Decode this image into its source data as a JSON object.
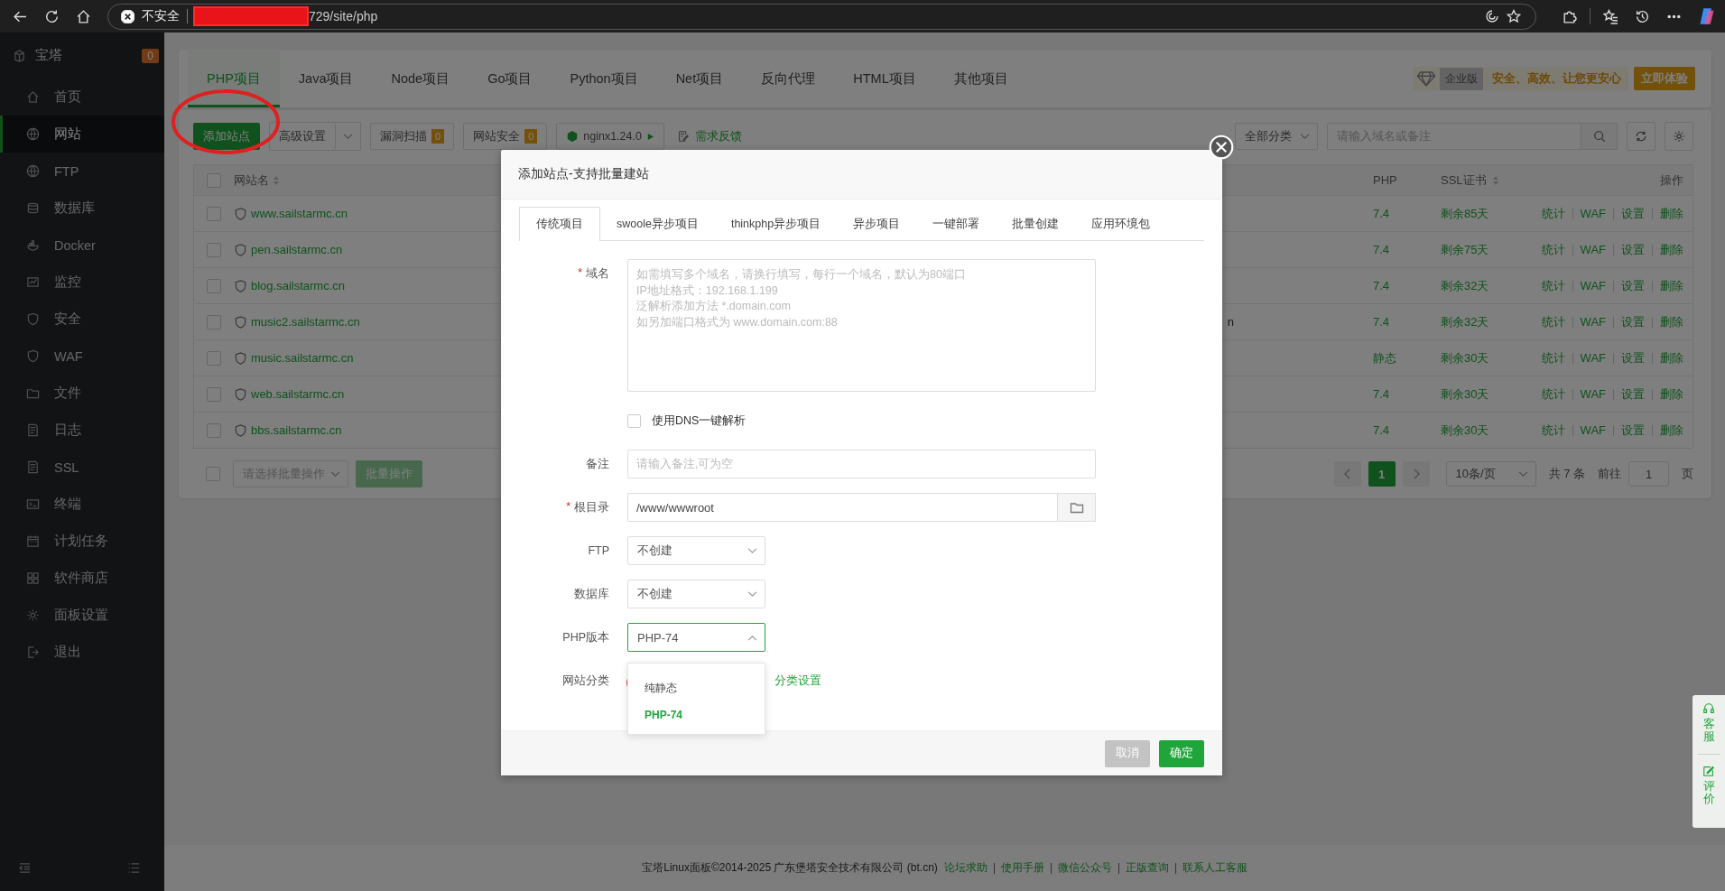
{
  "browser": {
    "security": "不安全",
    "url": "729/site/php"
  },
  "sidebar": {
    "title": "宝塔",
    "badge": "0",
    "items": [
      {
        "label": "首页",
        "selected": false
      },
      {
        "label": "网站",
        "selected": true
      },
      {
        "label": "FTP",
        "selected": false
      },
      {
        "label": "数据库",
        "selected": false
      },
      {
        "label": "Docker",
        "selected": false
      },
      {
        "label": "监控",
        "selected": false
      },
      {
        "label": "安全",
        "selected": false
      },
      {
        "label": "WAF",
        "selected": false
      },
      {
        "label": "文件",
        "selected": false
      },
      {
        "label": "日志",
        "selected": false
      },
      {
        "label": "SSL",
        "selected": false
      },
      {
        "label": "终端",
        "selected": false
      },
      {
        "label": "计划任务",
        "selected": false
      },
      {
        "label": "软件商店",
        "selected": false
      },
      {
        "label": "面板设置",
        "selected": false
      },
      {
        "label": "退出",
        "selected": false
      }
    ]
  },
  "project_tabs": [
    {
      "label": "PHP项目",
      "selected": true
    },
    {
      "label": "Java项目",
      "selected": false
    },
    {
      "label": "Node项目",
      "selected": false
    },
    {
      "label": "Go项目",
      "selected": false
    },
    {
      "label": "Python项目",
      "selected": false
    },
    {
      "label": "Net项目",
      "selected": false
    },
    {
      "label": "反向代理",
      "selected": false
    },
    {
      "label": "HTML项目",
      "selected": false
    },
    {
      "label": "其他项目",
      "selected": false
    }
  ],
  "promo": {
    "tag": "企业版",
    "text": "安全、高效、让您更安心",
    "button": "立即体验"
  },
  "toolbar": {
    "add_site": "添加站点",
    "advanced": "高级设置",
    "scan": "漏洞扫描",
    "scan_count": "0",
    "security": "网站安全",
    "security_count": "0",
    "nginx": "nginx1.24.0",
    "feedback": "需求反馈",
    "category": "全部分类",
    "search_placeholder": "请输入域名或备注"
  },
  "table": {
    "all_checked": false,
    "columns": [
      "网站名",
      "PHP",
      "SSL证书",
      "操作"
    ],
    "rows": [
      {
        "name": "www.sailstarmc.cn",
        "checked": false,
        "php": "7.4",
        "ssl": "剩余85天",
        "actions": [
          "统计",
          "WAF",
          "设置",
          "删除"
        ]
      },
      {
        "name": "pen.sailstarmc.cn",
        "checked": false,
        "php": "7.4",
        "ssl": "剩余75天",
        "actions": [
          "统计",
          "WAF",
          "设置",
          "删除"
        ]
      },
      {
        "name": "blog.sailstarmc.cn",
        "checked": false,
        "php": "7.4",
        "ssl": "剩余32天",
        "actions": [
          "统计",
          "WAF",
          "设置",
          "删除"
        ]
      },
      {
        "name": "music2.sailstarmc.cn",
        "checked": false,
        "column_3": "n",
        "php": "7.4",
        "ssl": "剩余32天",
        "actions": [
          "统计",
          "WAF",
          "设置",
          "删除"
        ]
      },
      {
        "name": "music.sailstarmc.cn",
        "checked": false,
        "php": "静态",
        "ssl": "剩余30天",
        "actions": [
          "统计",
          "WAF",
          "设置",
          "删除"
        ]
      },
      {
        "name": "web.sailstarmc.cn",
        "checked": false,
        "php": "7.4",
        "ssl": "剩余30天",
        "actions": [
          "统计",
          "WAF",
          "设置",
          "删除"
        ]
      },
      {
        "name": "bbs.sailstarmc.cn",
        "checked": false,
        "php": "7.4",
        "ssl": "剩余30天",
        "actions": [
          "统计",
          "WAF",
          "设置",
          "删除"
        ]
      }
    ]
  },
  "batch": {
    "checked": false,
    "placeholder": "请选择批量操作",
    "button": "批量操作"
  },
  "pagination": {
    "page": "1",
    "page_size": "10条/页",
    "total": "共 7 条",
    "goto": "前往",
    "goto_value": "1",
    "page_unit": "页"
  },
  "modal": {
    "title": "添加站点-支持批量建站",
    "tabs": [
      {
        "label": "传统项目",
        "selected": true
      },
      {
        "label": "swoole异步项目",
        "selected": false
      },
      {
        "label": "thinkphp异步项目",
        "selected": false
      },
      {
        "label": "异步项目",
        "selected": false
      },
      {
        "label": "一键部署",
        "selected": false
      },
      {
        "label": "批量创建",
        "selected": false
      },
      {
        "label": "应用环境包",
        "selected": false
      }
    ],
    "domain": {
      "label": "域名",
      "required_mark": "*",
      "placeholder": "如需填写多个域名，请换行填写，每行一个域名，默认为80端口\nIP地址格式：192.168.1.199\n泛解析添加方法 *.domain.com\n如另加端口格式为 www.domain.com:88"
    },
    "dns": {
      "label": "使用DNS一键解析",
      "checked": false
    },
    "note": {
      "label": "备注",
      "placeholder": "请输入备注,可为空"
    },
    "root": {
      "label": "根目录",
      "required_mark": "*",
      "value": "/www/wwwroot"
    },
    "ftp": {
      "label": "FTP",
      "value": "不创建"
    },
    "database": {
      "label": "数据库",
      "value": "不创建"
    },
    "php": {
      "label": "PHP版本",
      "value": "PHP-74",
      "expanded": true,
      "options": [
        {
          "label": "纯静态",
          "selected": false
        },
        {
          "label": "PHP-74",
          "selected": true
        }
      ]
    },
    "category": {
      "label": "网站分类",
      "link": "分类设置"
    },
    "cancel": "取消",
    "confirm": "确定"
  },
  "float_panel": {
    "service": "客服",
    "rate": "评价"
  },
  "footer": {
    "copyright": "宝塔Linux面板©2014-2025 广东堡塔安全技术有限公司 (bt.cn)",
    "links": [
      "论坛求助",
      "使用手册",
      "微信公众号",
      "正版查询",
      "联系人工客服"
    ]
  }
}
